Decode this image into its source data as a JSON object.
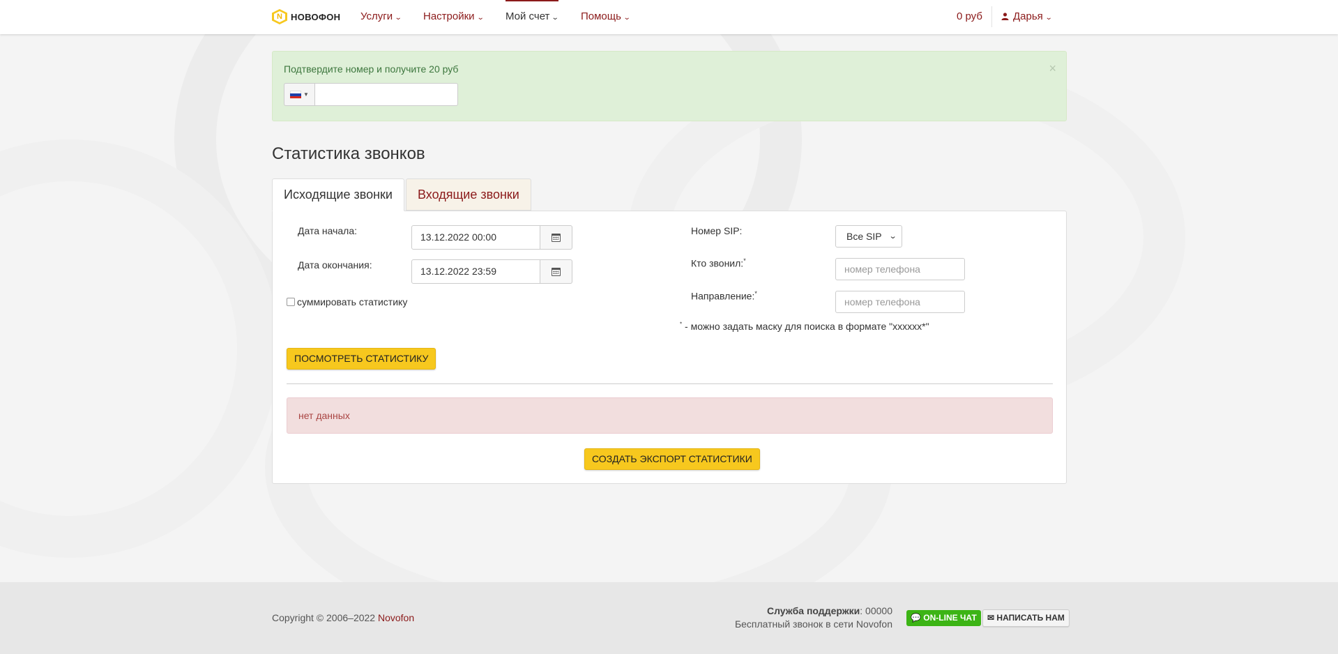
{
  "colors": {
    "accent": "#8b1a1a",
    "yellow": "#f7c81e",
    "success_bg": "#dff0d8",
    "danger_bg": "#f2dede",
    "chat_green": "#3cb415"
  },
  "logo": {
    "letter": "N",
    "text": "НОВОФОН"
  },
  "nav": {
    "items": [
      {
        "label": "Услуги",
        "icon": "chevron-down-icon"
      },
      {
        "label": "Настройки",
        "icon": "chevron-down-icon"
      },
      {
        "label": "Мой счет",
        "icon": "chevron-down-icon",
        "active": true
      },
      {
        "label": "Помощь",
        "icon": "chevron-down-icon"
      }
    ],
    "balance": "0 руб",
    "user": "Дарья"
  },
  "verify_alert": {
    "text": "Подтвердите номер и получите 20 руб",
    "close": "×",
    "country_flag": "ru-flag-icon",
    "phone_value": ""
  },
  "page_title": "Статистика звонков",
  "tabs": [
    {
      "label": "Исходящие звонки",
      "active": true
    },
    {
      "label": "Входящие звонки",
      "active": false
    }
  ],
  "form": {
    "start_label": "Дата начала:",
    "start_value": "13.12.2022 00:00",
    "end_label": "Дата окончания:",
    "end_value": "13.12.2022 23:59",
    "sum_label": "суммировать статистику",
    "sum_checked": false,
    "sip_label": "Номер SIP:",
    "sip_value": "Все SIP",
    "caller_label": "Кто звонил:",
    "caller_placeholder": "номер телефона",
    "direction_label": "Направление:",
    "direction_placeholder": "номер телефона",
    "asterisk": "*",
    "hint": " - можно задать маску для поиска в формате \"xxxxxx*\"",
    "view_button": "ПОСМОТРЕТЬ СТАТИСТИКУ"
  },
  "no_data": "нет данных",
  "export_button": "СОЗДАТЬ ЭКСПОРТ СТАТИСТИКИ",
  "footer": {
    "copyright": "Copyright © 2006–2022 ",
    "brand": "Novofon",
    "support_label": "Служба поддержки",
    "support_number": ": 00000",
    "free_call": "Бесплатный звонок в сети Novofon",
    "chat_button": "ON-LINE ЧАТ",
    "mail_button": "НАПИСАТЬ НАМ"
  }
}
